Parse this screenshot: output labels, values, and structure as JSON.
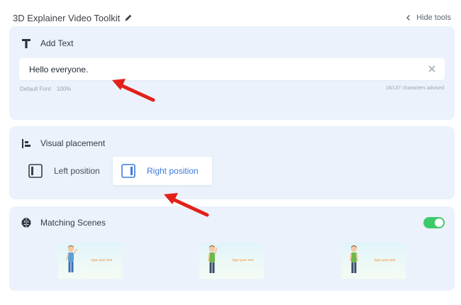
{
  "header": {
    "title": "3D Explainer Video Toolkit",
    "hide_tools": "Hide tools"
  },
  "add_text": {
    "title": "Add Text",
    "input_value": "Hello everyone.",
    "font": "Default Font",
    "size": "100%",
    "counter": "16/137 characters advised"
  },
  "placement": {
    "title": "Visual placement",
    "left_label": "Left position",
    "right_label": "Right position",
    "selected": "right"
  },
  "scenes": {
    "title": "Matching Scenes",
    "toggle_on": true,
    "items": [
      {
        "text": "Type your text"
      },
      {
        "text": "Type your text"
      },
      {
        "text": "Type your text"
      }
    ]
  },
  "colors": {
    "panel_bg": "#ebf2fb",
    "accent": "#3d7be0",
    "toggle": "#3fca6a",
    "arrow": "#e3201b"
  }
}
